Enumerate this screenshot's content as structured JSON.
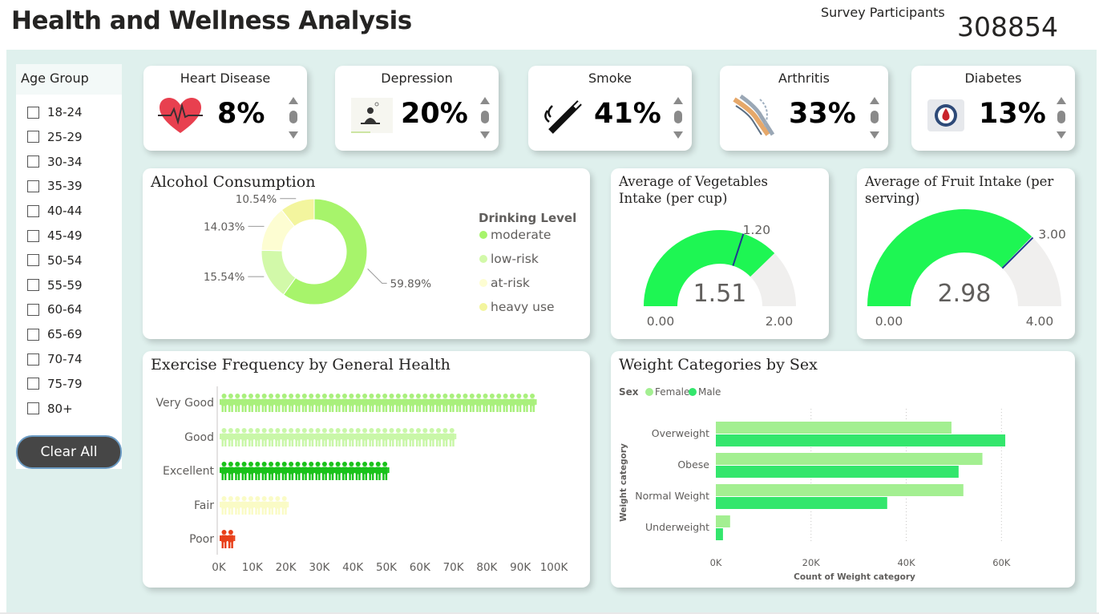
{
  "header": {
    "title": "Health and Wellness Analysis",
    "participants_label": "Survey Participants",
    "participants_value": "308854"
  },
  "slicer": {
    "title": "Age Group",
    "items": [
      "18-24",
      "25-29",
      "30-34",
      "35-39",
      "40-44",
      "45-49",
      "50-54",
      "55-59",
      "60-64",
      "65-69",
      "70-74",
      "75-79",
      "80+"
    ],
    "clear_label": "Clear All"
  },
  "kpis": [
    {
      "title": "Heart Disease",
      "value": "8%",
      "icon": "heart-pulse-icon"
    },
    {
      "title": "Depression",
      "value": "20%",
      "icon": "depressed-person-icon"
    },
    {
      "title": "Smoke",
      "value": "41%",
      "icon": "cigarette-icon"
    },
    {
      "title": "Arthritis",
      "value": "33%",
      "icon": "knee-joint-icon"
    },
    {
      "title": "Diabetes",
      "value": "13%",
      "icon": "blood-drop-icon"
    }
  ],
  "colors": {
    "canvas": "#dff0ed",
    "moderate": "#a7f46b",
    "low_risk": "#d2f9a9",
    "at_risk": "#fdfdd2",
    "heavy_use": "#f3f59e",
    "gauge_fill": "#1ef653",
    "gauge_bg": "#f0efee",
    "female": "#a3ef91",
    "male": "#33e66c",
    "very_good": "#a9f07c",
    "good": "#c9f7a8",
    "excellent": "#19c21a",
    "fair": "#fafbc6",
    "poor": "#e8401a"
  },
  "alcohol": {
    "title": "Alcohol Consumption",
    "legend_title": "Drinking Level",
    "chart_data": {
      "type": "pie",
      "donut": true,
      "categories": [
        "moderate",
        "low-risk",
        "at-risk",
        "heavy use"
      ],
      "values": [
        59.89,
        15.54,
        14.03,
        10.54
      ],
      "labels": [
        "59.89%",
        "15.54%",
        "14.03%",
        "10.54%"
      ],
      "legend_position": "right"
    }
  },
  "veg_gauge": {
    "title": "Average of Vegetables Intake (per cup)",
    "chart_data": {
      "type": "gauge",
      "value": 1.51,
      "min": 0,
      "max": 2,
      "target": 1.2
    },
    "value_label": "1.51",
    "min_label": "0.00",
    "max_label": "2.00",
    "target_label": "1.20"
  },
  "fruit_gauge": {
    "title": "Average of Fruit Intake (per serving)",
    "chart_data": {
      "type": "gauge",
      "value": 2.98,
      "min": 0,
      "max": 4,
      "target": 3
    },
    "value_label": "2.98",
    "min_label": "0.00",
    "max_label": "4.00",
    "target_label": "3.00"
  },
  "exercise": {
    "title": "Exercise Frequency by General Health",
    "chart_data": {
      "type": "bar",
      "orientation": "horizontal",
      "categories": [
        "Very Good",
        "Good",
        "Excellent",
        "Fair",
        "Poor"
      ],
      "values": [
        93000,
        70000,
        49000,
        20000,
        3000
      ],
      "xlim": [
        0,
        100000
      ],
      "xticks": [
        "0K",
        "10K",
        "20K",
        "30K",
        "40K",
        "50K",
        "60K",
        "70K",
        "80K",
        "90K",
        "100K"
      ],
      "mark": "person-pictogram"
    }
  },
  "weight": {
    "title": "Weight Categories by Sex",
    "legend_title": "Sex",
    "chart_data": {
      "type": "bar",
      "orientation": "horizontal",
      "categories": [
        "Overweight",
        "Obese",
        "Normal Weight",
        "Underweight"
      ],
      "series": [
        {
          "name": "Female",
          "values": [
            49500,
            56000,
            52000,
            3000
          ]
        },
        {
          "name": "Male",
          "values": [
            60800,
            51000,
            36000,
            1500
          ]
        }
      ],
      "xlim": [
        0,
        65000
      ],
      "xticks": [
        "0K",
        "20K",
        "40K",
        "60K"
      ],
      "xlabel": "Count of Weight category",
      "ylabel": "Weight category",
      "legend_position": "top-left"
    }
  }
}
